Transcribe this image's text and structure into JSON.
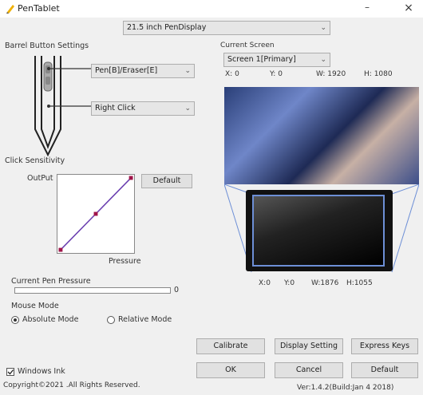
{
  "window": {
    "title": "PenTablet",
    "minimize_glyph": "–",
    "close_glyph": "×"
  },
  "device": {
    "selected": "21.5 inch PenDisplay"
  },
  "barrel": {
    "section_label": "Barrel Button Settings",
    "button1_value": "Pen[B]/Eraser[E]",
    "button2_value": "Right Click"
  },
  "sensitivity": {
    "section_label": "Click Sensitivity",
    "output_label": "OutPut",
    "pressure_label": "Pressure",
    "default_label": "Default",
    "curve_points": [
      [
        0,
        0
      ],
      [
        0.5,
        0.5
      ],
      [
        1,
        1
      ]
    ]
  },
  "pen_pressure": {
    "label": "Current Pen Pressure",
    "value": "0",
    "level": 0
  },
  "mouse_mode": {
    "label": "Mouse Mode",
    "absolute_label": "Absolute Mode",
    "relative_label": "Relative Mode",
    "selected": "absolute"
  },
  "screen": {
    "section_label": "Current Screen",
    "selected": "Screen 1[Primary]",
    "x_label": "X:",
    "x": "0",
    "y_label": "Y:",
    "y": "0",
    "w_label": "W:",
    "w": "1920",
    "h_label": "H:",
    "h": "1080"
  },
  "tablet_area": {
    "x_label": "X:",
    "x": "0",
    "y_label": "Y:",
    "y": "0",
    "w_label": "W:",
    "w": "1876",
    "h_label": "H:",
    "h": "1055"
  },
  "buttons": {
    "calibrate": "Calibrate",
    "display_setting": "Display Setting",
    "express_keys": "Express Keys",
    "ok": "OK",
    "cancel": "Cancel",
    "default": "Default"
  },
  "windows_ink": {
    "label": "Windows Ink",
    "checked": true
  },
  "footer": {
    "copyright": "Copyright©2021 .All Rights Reserved.",
    "version": "Ver:1.4.2(Build:Jan  4 2018)"
  },
  "colors": {
    "curve": "#6a3fb0",
    "curve_point": "#a0154a",
    "mapping_lines": "#6d8fd6",
    "tablet_border": "#6d8fd6"
  }
}
